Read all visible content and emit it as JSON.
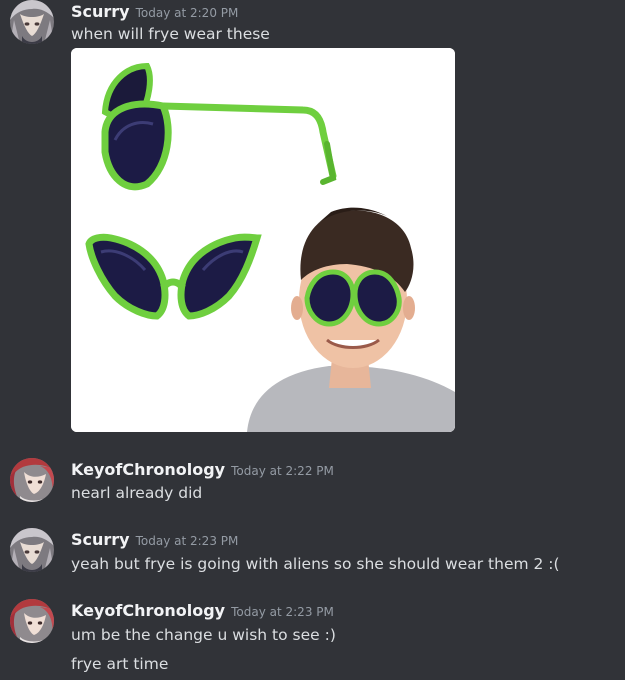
{
  "messages": [
    {
      "author": "Scurry",
      "timestamp": "Today at 2:20 PM",
      "lines": [
        "when will frye wear these"
      ],
      "attachment": {
        "kind": "image",
        "subject": "green alien sunglasses product photo"
      }
    },
    {
      "author": "KeyofChronology",
      "timestamp": "Today at 2:22 PM",
      "lines": [
        "nearl already did"
      ]
    },
    {
      "author": "Scurry",
      "timestamp": "Today at 2:23 PM",
      "lines": [
        "yeah but frye is going with aliens so she should wear them 2 :("
      ]
    },
    {
      "author": "KeyofChronology",
      "timestamp": "Today at 2:23 PM",
      "lines": [
        "um be the change u wish to see :)",
        "frye art time"
      ]
    }
  ],
  "colors": {
    "background": "#313338",
    "username": "#f2f3f5",
    "timestamp": "#949ba4",
    "message_text": "#dbdee1",
    "glasses_frame": "#6fcf3f"
  },
  "icons": {
    "scurry_avatar": "avatar-grey-haired-character",
    "key_avatar": "avatar-red-haired-character"
  }
}
